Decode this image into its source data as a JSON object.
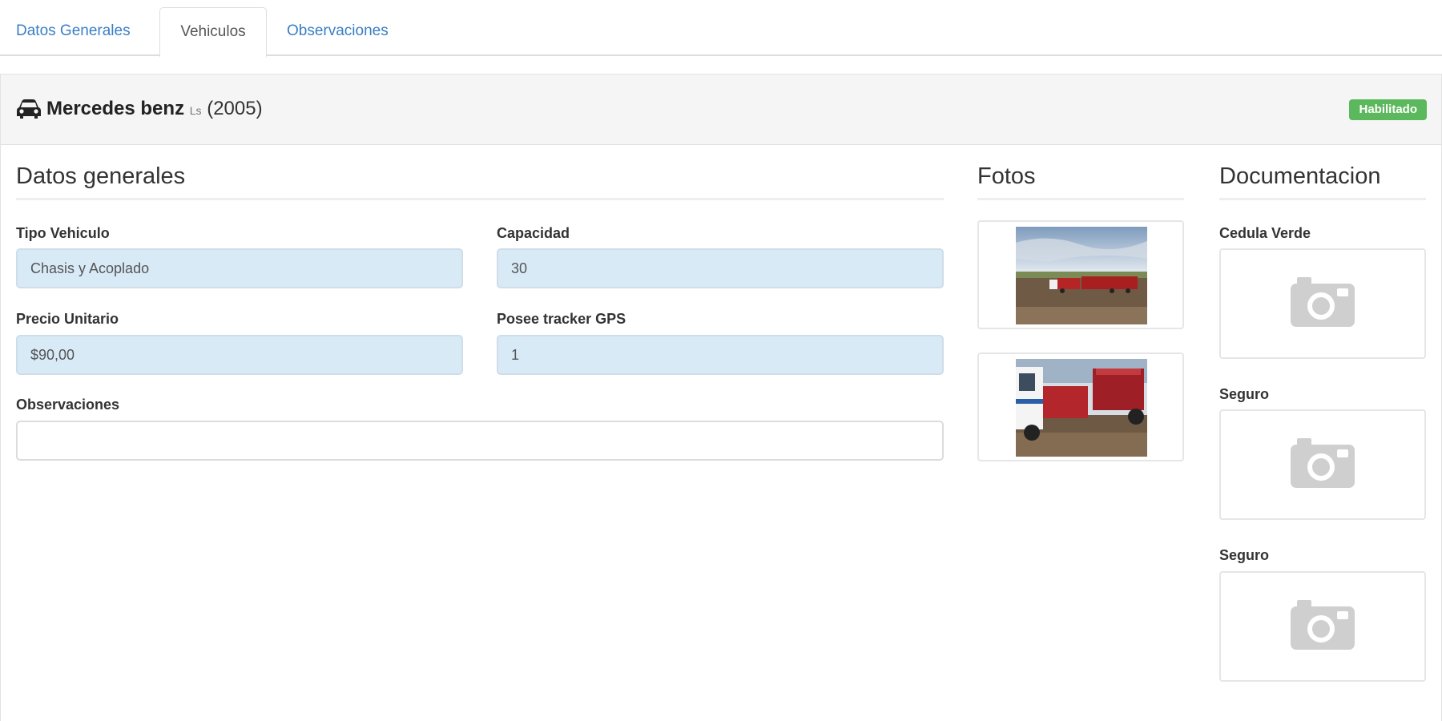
{
  "tabs": [
    {
      "label": "Datos Generales",
      "active": false
    },
    {
      "label": "Vehiculos",
      "active": true
    },
    {
      "label": "Observaciones",
      "active": false
    }
  ],
  "vehicle": {
    "icon": "car-icon",
    "brand": "Mercedes benz",
    "model": "Ls",
    "year": "(2005)",
    "status": "Habilitado",
    "status_color": "#5cb85c"
  },
  "general": {
    "title": "Datos generales",
    "fields": {
      "tipo_vehiculo": {
        "label": "Tipo Vehiculo",
        "value": "Chasis y Acoplado"
      },
      "capacidad": {
        "label": "Capacidad",
        "value": "30"
      },
      "precio_unitario": {
        "label": "Precio Unitario",
        "value": "$90,00"
      },
      "tracker_gps": {
        "label": "Posee tracker GPS",
        "value": "1"
      },
      "observaciones": {
        "label": "Observaciones",
        "value": ""
      }
    }
  },
  "photos": {
    "title": "Fotos",
    "items": [
      "truck-photo-1",
      "truck-photo-2"
    ]
  },
  "documentation": {
    "title": "Documentacion",
    "items": [
      {
        "label": "Cedula Verde",
        "icon": "camera-icon"
      },
      {
        "label": "Seguro",
        "icon": "camera-icon"
      },
      {
        "label": "Seguro",
        "icon": "camera-icon"
      }
    ]
  },
  "colors": {
    "link": "#3a7fc4",
    "field_bg": "#d9eaf7",
    "heading_bg": "#f5f5f5"
  }
}
